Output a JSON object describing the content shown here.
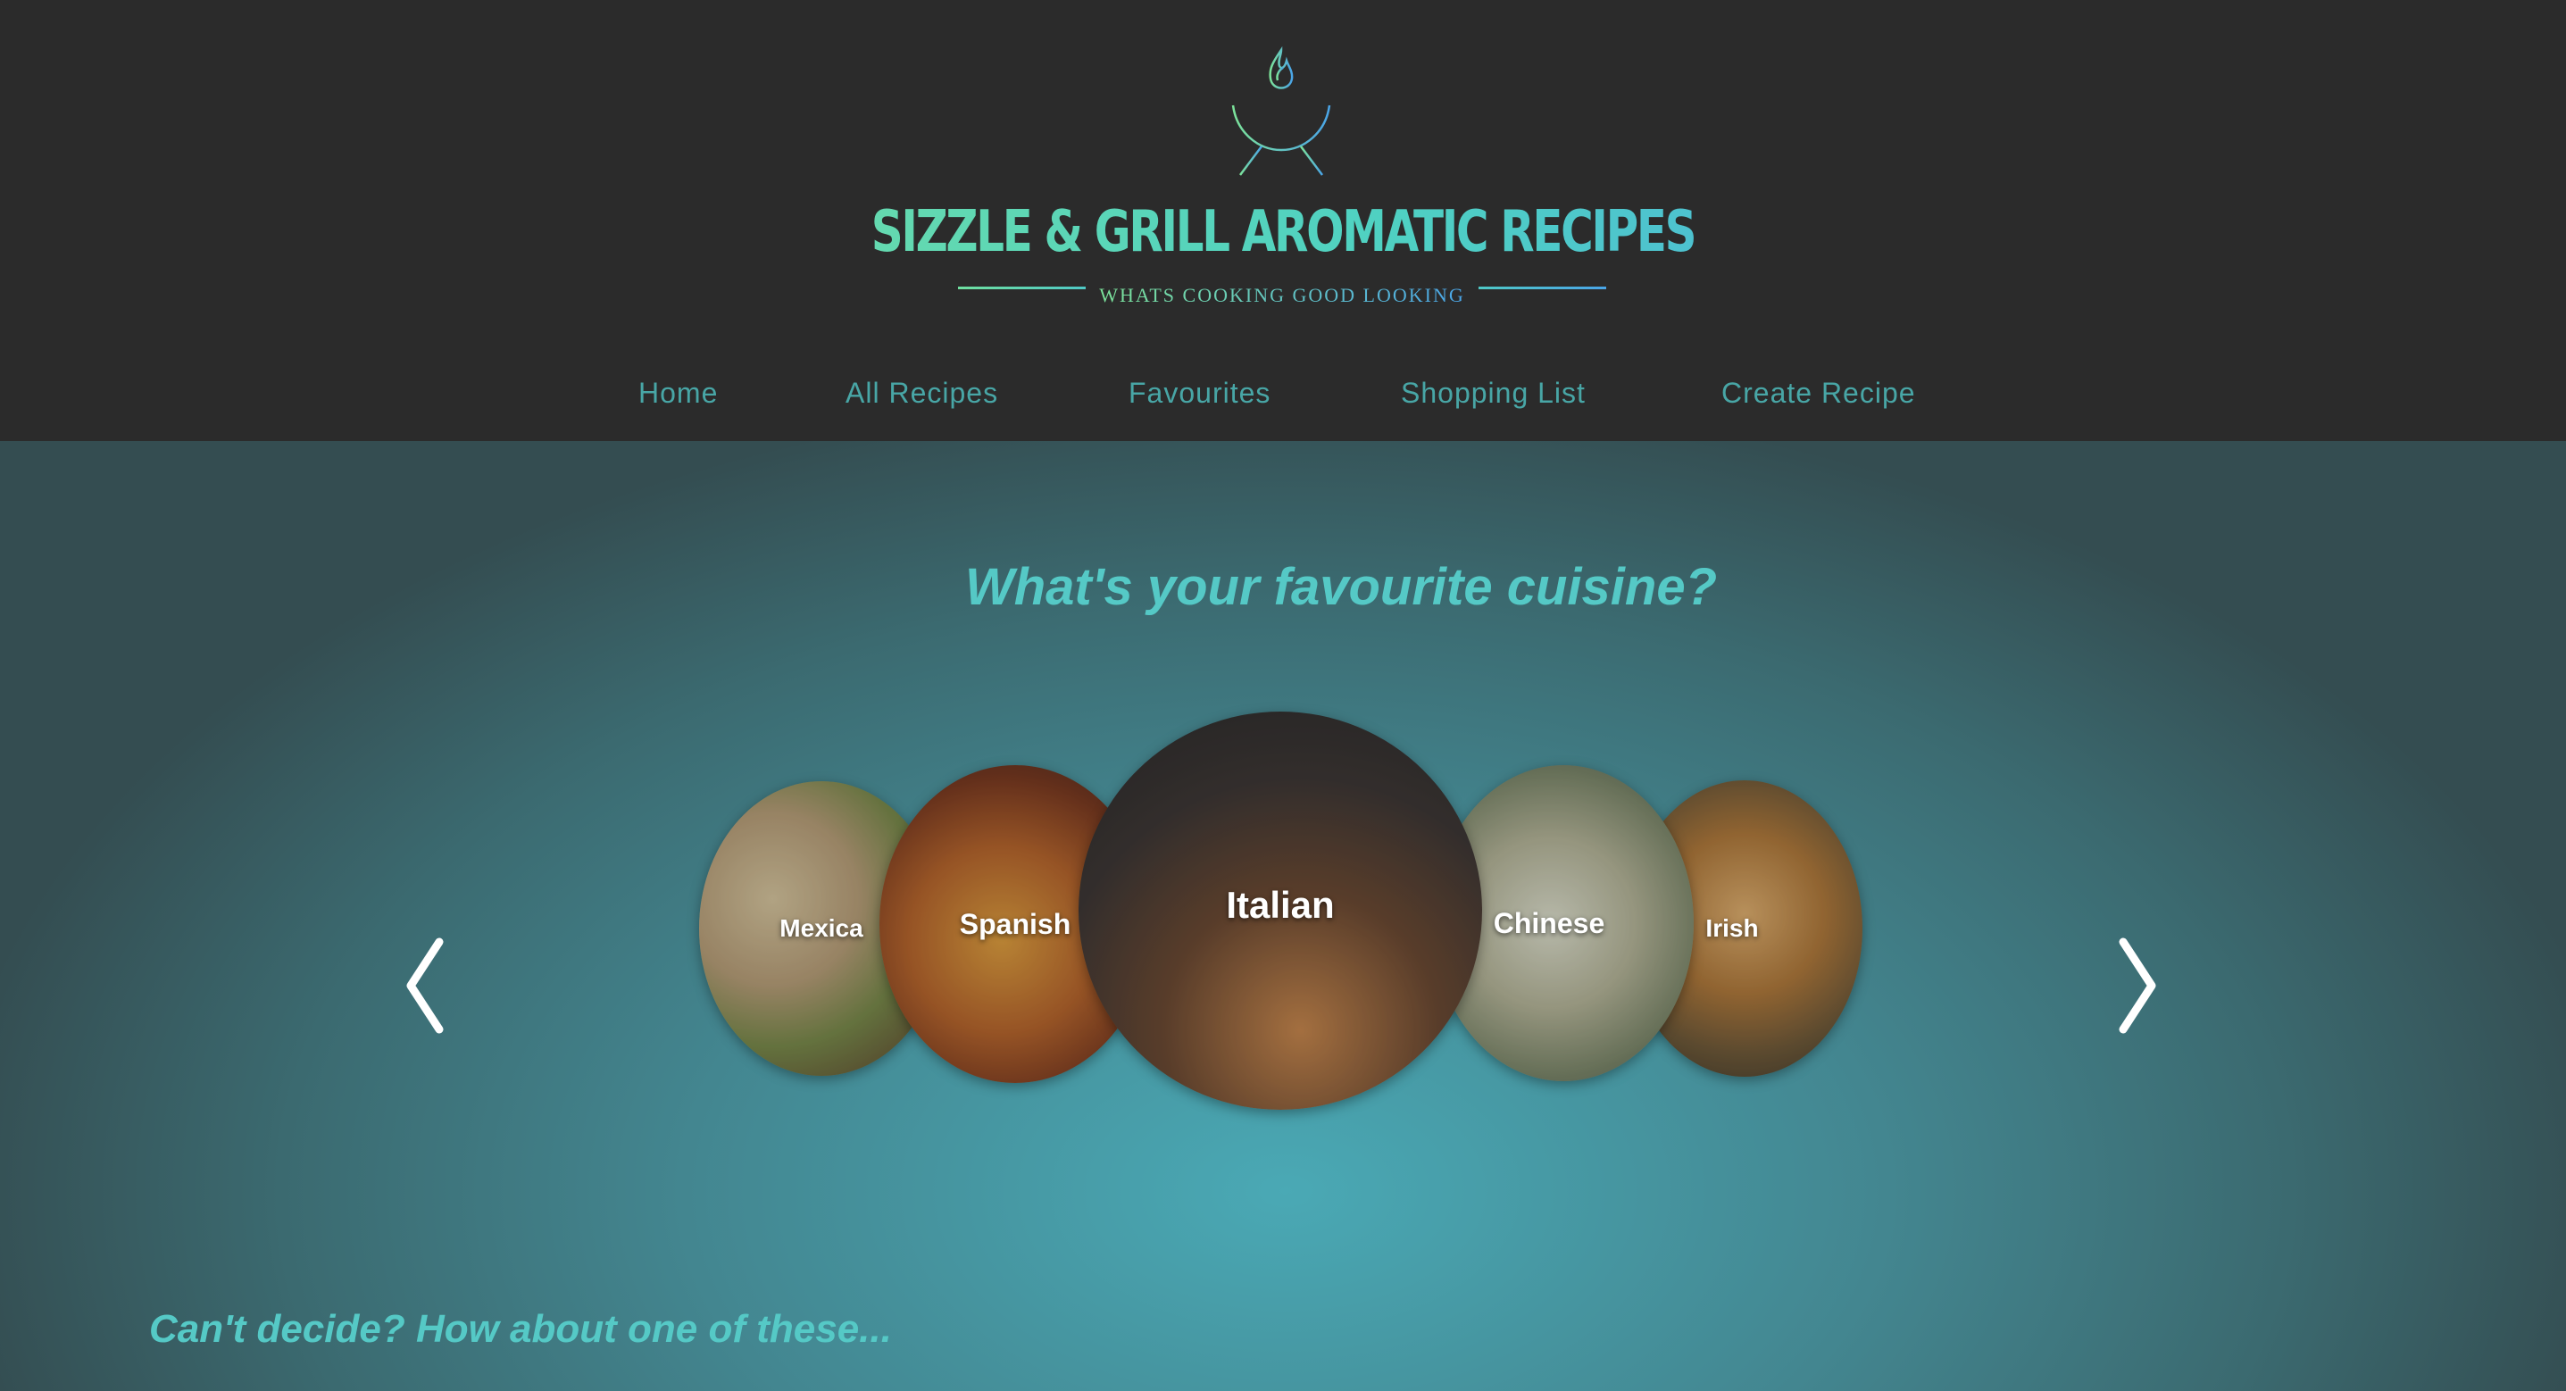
{
  "header": {
    "brand": "SIZZLE & GRILL AROMATIC RECIPES",
    "tagline": "WHATS COOKING GOOD LOOKING",
    "logo_icon": "grill-icon"
  },
  "nav": {
    "items": [
      {
        "label": "Home"
      },
      {
        "label": "All Recipes"
      },
      {
        "label": "Favourites"
      },
      {
        "label": "Shopping List"
      },
      {
        "label": "Create Recipe"
      }
    ]
  },
  "main": {
    "heading": "What's your favourite cuisine?",
    "subheading": "Can't decide? How about one of these...",
    "carousel": {
      "prev_icon": "chevron-left-icon",
      "next_icon": "chevron-right-icon",
      "cuisines": [
        {
          "label": "Mexica"
        },
        {
          "label": "Spanish"
        },
        {
          "label": "Italian"
        },
        {
          "label": "Chinese"
        },
        {
          "label": "Irish"
        }
      ]
    }
  },
  "colors": {
    "header_bg": "#2b2b2b",
    "nav_text": "#48a6a6",
    "accent": "#55c9c6",
    "brand_green": "#7ce39a",
    "brand_blue": "#4aa5e8"
  }
}
